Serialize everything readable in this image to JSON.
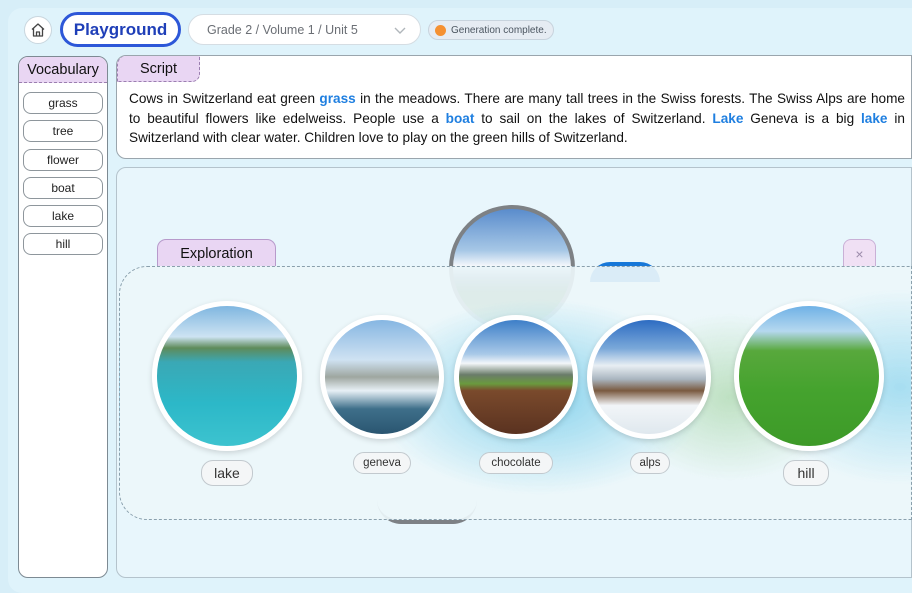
{
  "header": {
    "app_title": "Playground",
    "grade_selector": "Grade 2 / Volume 1 / Unit 5",
    "status": "Generation complete."
  },
  "vocabulary": {
    "title": "Vocabulary",
    "items": [
      "grass",
      "tree",
      "flower",
      "boat",
      "lake",
      "hill"
    ]
  },
  "script": {
    "title": "Script",
    "segments": [
      {
        "text": "Cows in Switzerland eat green ",
        "highlight": false
      },
      {
        "text": "grass",
        "highlight": true
      },
      {
        "text": " in the meadows. There are many tall trees in the Swiss forests. The Swiss Alps are home to beautiful flowers like edelweiss. People use a ",
        "highlight": false
      },
      {
        "text": "boat",
        "highlight": true
      },
      {
        "text": " to sail on the lakes of Switzerland. ",
        "highlight": false
      },
      {
        "text": "Lake",
        "highlight": true
      },
      {
        "text": " Geneva is a big ",
        "highlight": false
      },
      {
        "text": "lake",
        "highlight": true
      },
      {
        "text": " in Switzerland with clear water. Children love to play on the green hills of Switzerland.",
        "highlight": false
      }
    ]
  },
  "exploration": {
    "title": "Exploration",
    "close_label": "×",
    "items": [
      "lake",
      "geneva",
      "chocolate",
      "alps",
      "hill"
    ]
  },
  "colors": {
    "accent": "#2d57d8",
    "highlight_word": "#1f7fe0",
    "status_dot": "#f59031",
    "tab_bg": "#e9d6f3"
  }
}
